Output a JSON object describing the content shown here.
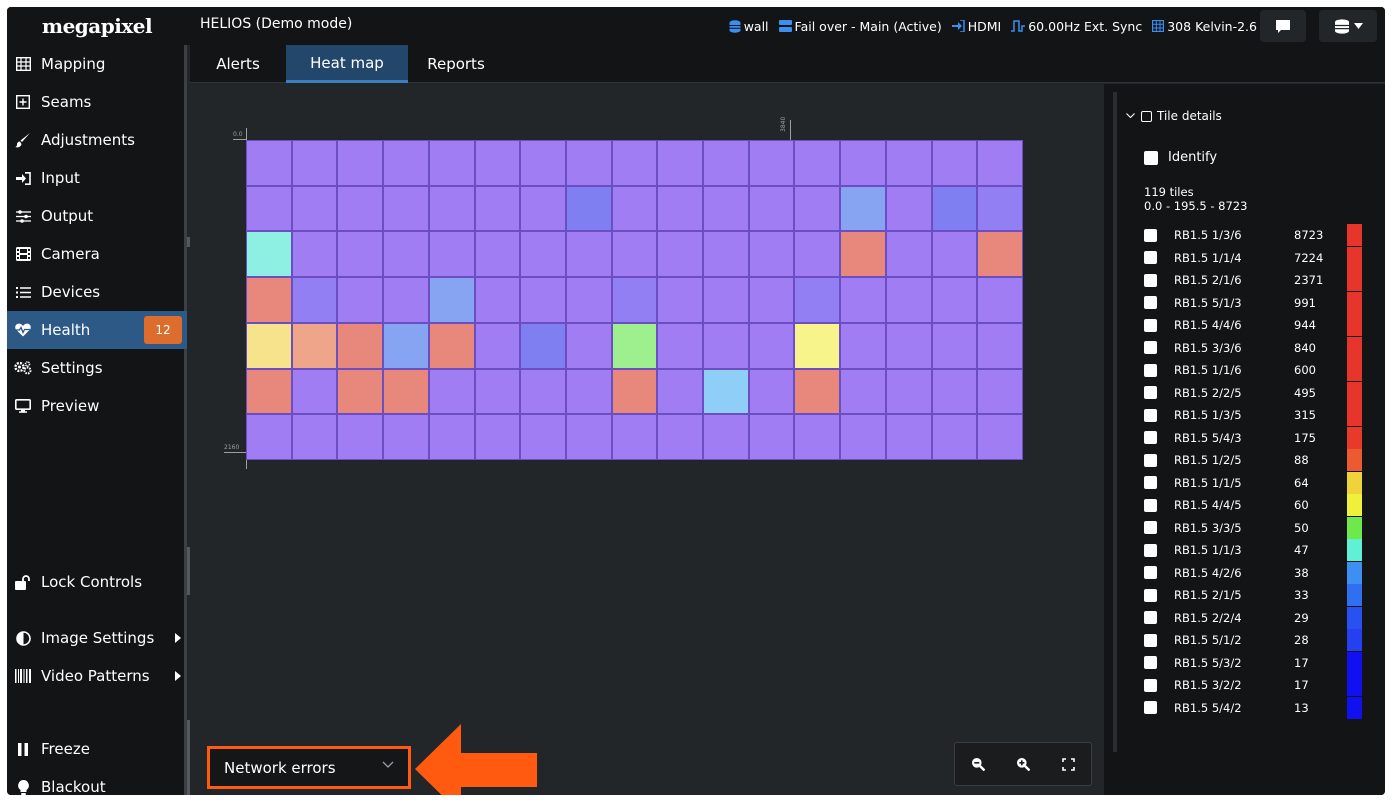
{
  "app": {
    "logo": "megapixel",
    "title": "HELIOS (Demo mode)"
  },
  "status": {
    "wall": "wall",
    "failover": "Fail over - Main (Active)",
    "input": "HDMI",
    "sync": "60.00Hz Ext. Sync",
    "grid": "308 Kelvin-2.6"
  },
  "sidebar": {
    "items": [
      {
        "label": "Mapping",
        "icon": "grid-icon"
      },
      {
        "label": "Seams",
        "icon": "plus-square-icon"
      },
      {
        "label": "Adjustments",
        "icon": "brush-icon"
      },
      {
        "label": "Input",
        "icon": "sign-in-icon"
      },
      {
        "label": "Output",
        "icon": "sliders-icon"
      },
      {
        "label": "Camera",
        "icon": "film-icon"
      },
      {
        "label": "Devices",
        "icon": "list-icon"
      },
      {
        "label": "Health",
        "icon": "heartbeat-icon",
        "badge": "12"
      },
      {
        "label": "Settings",
        "icon": "cogs-icon"
      },
      {
        "label": "Preview",
        "icon": "monitor-icon"
      }
    ],
    "lock_controls": "Lock Controls",
    "image_settings": "Image Settings",
    "video_patterns": "Video Patterns",
    "freeze": "Freeze",
    "blackout": "Blackout"
  },
  "tabs": [
    "Alerts",
    "Heat map",
    "Reports"
  ],
  "heatmap": {
    "axis": {
      "x0": "0.0",
      "x1": "3840",
      "y1": "2160"
    },
    "rows": 7,
    "cols": 17,
    "cells": [
      [
        "#a07df3",
        "#a07df3",
        "#a07df3",
        "#a07df3",
        "#a07df3",
        "#a07df3",
        "#a07df3",
        "#a07df3",
        "#a07df3",
        "#a07df3",
        "#a07df3",
        "#a07df3",
        "#a07df3",
        "#a07df3",
        "#a07df3",
        "#a07df3",
        "#a07df3"
      ],
      [
        "#a07df3",
        "#a07df3",
        "#a07df3",
        "#a07df3",
        "#a07df3",
        "#a07df3",
        "#a07df3",
        "#7f7ff2",
        "#a07df3",
        "#a07df3",
        "#a07df3",
        "#a07df3",
        "#a07df3",
        "#87a4f3",
        "#a07df3",
        "#7f7ff2",
        "#917ff3"
      ],
      [
        "#8ef0e2",
        "#a07df3",
        "#a07df3",
        "#a07df3",
        "#a07df3",
        "#a07df3",
        "#a07df3",
        "#a07df3",
        "#a07df3",
        "#a07df3",
        "#a07df3",
        "#a07df3",
        "#a07df3",
        "#e8877c",
        "#a07df3",
        "#a07df3",
        "#e8877c"
      ],
      [
        "#e8877c",
        "#917ff3",
        "#a07df3",
        "#a07df3",
        "#87a4f3",
        "#a07df3",
        "#a07df3",
        "#a07df3",
        "#917ff3",
        "#a07df3",
        "#a07df3",
        "#a07df3",
        "#917ff3",
        "#a07df3",
        "#a07df3",
        "#a07df3",
        "#a07df3"
      ],
      [
        "#f6e38b",
        "#eea58a",
        "#e8877c",
        "#87a4f3",
        "#e8877c",
        "#a07df3",
        "#7f7ff2",
        "#a07df3",
        "#9ef08e",
        "#a07df3",
        "#a07df3",
        "#a07df3",
        "#f6f48a",
        "#a07df3",
        "#a07df3",
        "#a07df3",
        "#a07df3"
      ],
      [
        "#e8877c",
        "#a07df3",
        "#e8877c",
        "#e8877c",
        "#a07df3",
        "#a07df3",
        "#a07df3",
        "#a07df3",
        "#e8877c",
        "#a07df3",
        "#8fcff7",
        "#a07df3",
        "#e8877c",
        "#a07df3",
        "#a07df3",
        "#a07df3",
        "#a07df3"
      ],
      [
        "#a07df3",
        "#a07df3",
        "#a07df3",
        "#a07df3",
        "#a07df3",
        "#a07df3",
        "#a07df3",
        "#a07df3",
        "#a07df3",
        "#a07df3",
        "#a07df3",
        "#a07df3",
        "#a07df3",
        "#a07df3",
        "#a07df3",
        "#a07df3",
        "#a07df3"
      ]
    ]
  },
  "metric_select": {
    "value": "Network errors"
  },
  "tile_details": {
    "title": "Tile details",
    "identify": "Identify",
    "count": "119 tiles",
    "range": "0.0 - 195.5 - 8723",
    "tiles": [
      {
        "name": "RB1.5 1/3/6",
        "value": "8723",
        "color": "#e8352b"
      },
      {
        "name": "RB1.5 1/1/4",
        "value": "7224",
        "color": "#e8352b"
      },
      {
        "name": "RB1.5 2/1/6",
        "value": "2371",
        "color": "#e8352b"
      },
      {
        "name": "RB1.5 5/1/3",
        "value": "991",
        "color": "#e8352b"
      },
      {
        "name": "RB1.5 4/4/6",
        "value": "944",
        "color": "#e8352b"
      },
      {
        "name": "RB1.5 3/3/6",
        "value": "840",
        "color": "#e8352b"
      },
      {
        "name": "RB1.5 1/1/6",
        "value": "600",
        "color": "#e8352b"
      },
      {
        "name": "RB1.5 2/2/5",
        "value": "495",
        "color": "#e8352b"
      },
      {
        "name": "RB1.5 1/3/5",
        "value": "315",
        "color": "#e8352b"
      },
      {
        "name": "RB1.5 5/4/3",
        "value": "175",
        "color": "#e8392b"
      },
      {
        "name": "RB1.5 1/2/5",
        "value": "88",
        "color": "#ec5a32"
      },
      {
        "name": "RB1.5 1/1/5",
        "value": "64",
        "color": "#f0d23a"
      },
      {
        "name": "RB1.5 4/4/5",
        "value": "60",
        "color": "#eef03c"
      },
      {
        "name": "RB1.5 3/3/5",
        "value": "50",
        "color": "#6ee84a"
      },
      {
        "name": "RB1.5 1/1/3",
        "value": "47",
        "color": "#5ff0d6"
      },
      {
        "name": "RB1.5 4/2/6",
        "value": "38",
        "color": "#3d8ff0"
      },
      {
        "name": "RB1.5 2/1/5",
        "value": "33",
        "color": "#2f6ff0"
      },
      {
        "name": "RB1.5 2/2/4",
        "value": "29",
        "color": "#2950f0"
      },
      {
        "name": "RB1.5 5/1/2",
        "value": "28",
        "color": "#2440f0"
      },
      {
        "name": "RB1.5 5/3/2",
        "value": "17",
        "color": "#1010f0"
      },
      {
        "name": "RB1.5 3/2/2",
        "value": "17",
        "color": "#1010f0"
      },
      {
        "name": "RB1.5 5/4/2",
        "value": "13",
        "color": "#1010f0"
      }
    ]
  },
  "colors": {
    "accent_orange": "#ff5a0f",
    "health_badge": "#dc6d2d",
    "active_nav": "#2d5986",
    "status_blue": "#3b8ff0"
  }
}
